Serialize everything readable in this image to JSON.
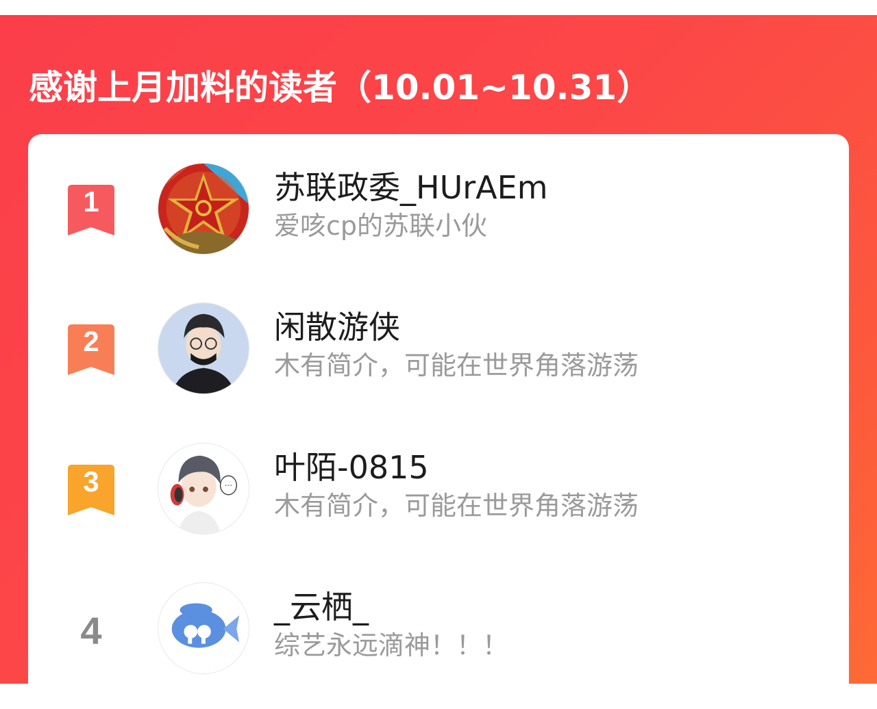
{
  "banner": {
    "title": "感谢上月加料的读者（10.01~10.31）"
  },
  "colors": {
    "banner_start": "#fb3e4a",
    "banner_end": "#fe6a35",
    "rank1": "#f65a5e",
    "rank2": "#f87e56",
    "rank3": "#f9a42a",
    "rank_plain": "#8a8a8a",
    "name": "#1c1c1c",
    "bio": "#9a9a9a"
  },
  "readers": [
    {
      "rank": "1",
      "name": "苏联政委_HUrAEm",
      "bio": "爱咳cp的苏联小伙",
      "avatar": "soviet-star-avatar"
    },
    {
      "rank": "2",
      "name": "闲散游侠",
      "bio": "木有简介，可能在世界角落游荡",
      "avatar": "glasses-boy-avatar"
    },
    {
      "rank": "3",
      "name": "叶陌-0815",
      "bio": "木有简介，可能在世界角落游荡",
      "avatar": "headphone-boy-avatar"
    },
    {
      "rank": "4",
      "name": "_云栖_",
      "bio": "综艺永远滴神！！！",
      "avatar": "blue-fish-avatar"
    }
  ]
}
